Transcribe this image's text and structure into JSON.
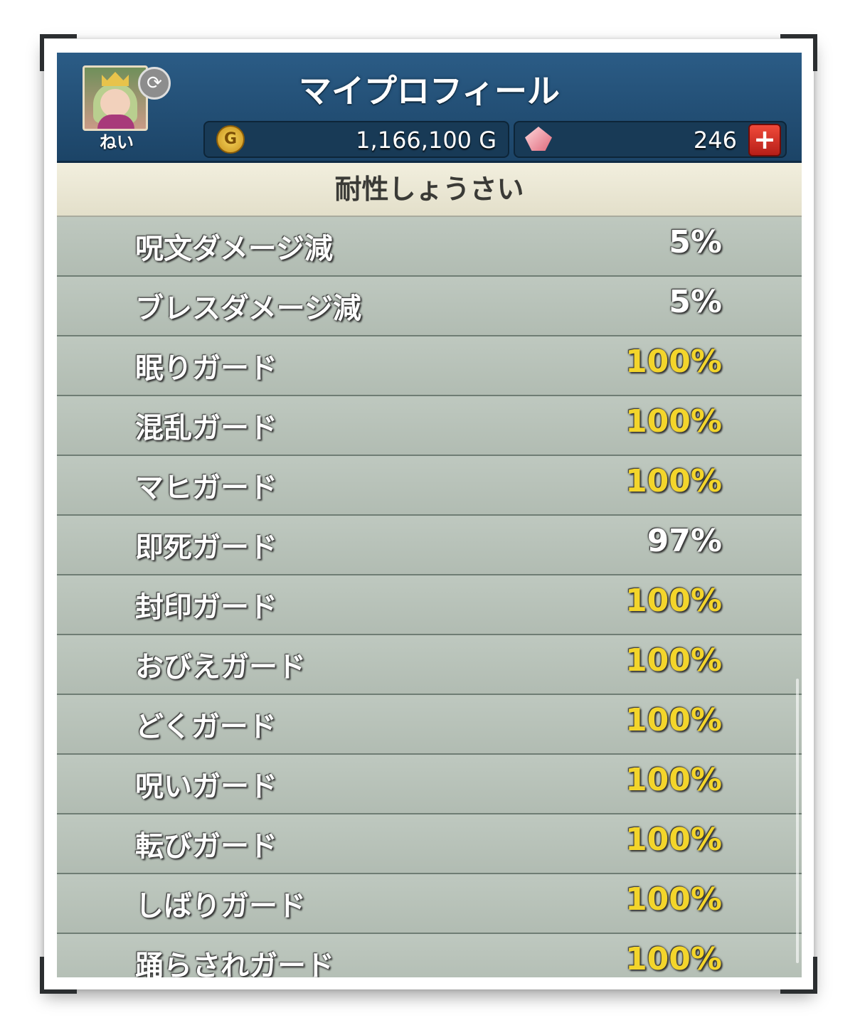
{
  "header": {
    "title": "マイプロフィール",
    "username": "ねい",
    "gold": "1,166,100 G",
    "gold_icon": "G",
    "gems": "246",
    "plus_label": "+"
  },
  "section_title": "耐性しょうさい",
  "resistances": [
    {
      "label": "呪文ダメージ減",
      "value": "5%"
    },
    {
      "label": "ブレスダメージ減",
      "value": "5%"
    },
    {
      "label": "眠りガード",
      "value": "100%"
    },
    {
      "label": "混乱ガード",
      "value": "100%"
    },
    {
      "label": "マヒガード",
      "value": "100%"
    },
    {
      "label": "即死ガード",
      "value": "97%"
    },
    {
      "label": "封印ガード",
      "value": "100%"
    },
    {
      "label": "おびえガード",
      "value": "100%"
    },
    {
      "label": "どくガード",
      "value": "100%"
    },
    {
      "label": "呪いガード",
      "value": "100%"
    },
    {
      "label": "転びガード",
      "value": "100%"
    },
    {
      "label": "しばりガード",
      "value": "100%"
    },
    {
      "label": "踊らされガード",
      "value": "100%"
    }
  ],
  "colors": {
    "header_bg": "#245276",
    "full_value": "#f3d52b",
    "partial_value": "#ffffff"
  }
}
